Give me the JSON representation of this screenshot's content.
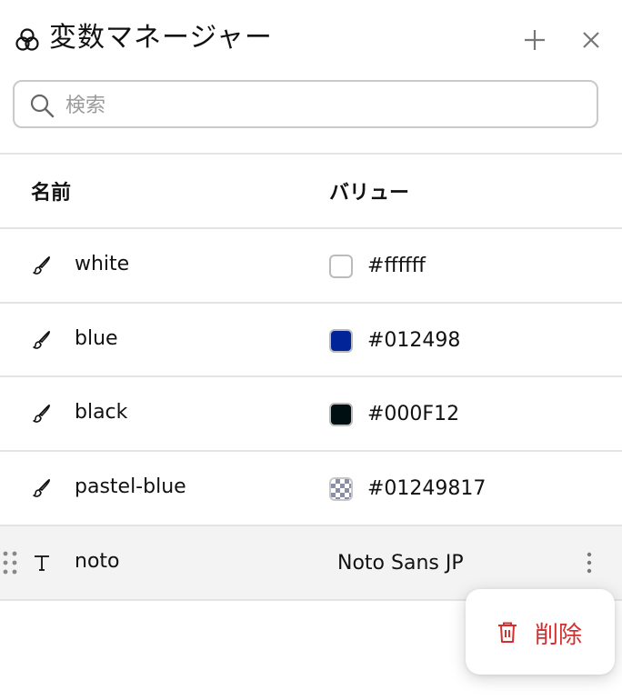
{
  "header": {
    "title": "変数マネージャー",
    "icons": {
      "title": "circles-icon",
      "add": "plus-icon",
      "close": "close-icon"
    }
  },
  "search": {
    "placeholder": "検索",
    "value": ""
  },
  "table": {
    "columns": {
      "name": "名前",
      "value": "バリュー"
    },
    "rows": [
      {
        "name": "white",
        "kind": "color",
        "kind_icon": "paintbrush-icon",
        "value": "#ffffff",
        "swatch": "#ffffff"
      },
      {
        "name": "blue",
        "kind": "color",
        "kind_icon": "paintbrush-icon",
        "value": "#012498",
        "swatch": "#012498"
      },
      {
        "name": "black",
        "kind": "color",
        "kind_icon": "paintbrush-icon",
        "value": "#000F12",
        "swatch": "#000F12"
      },
      {
        "name": "pastel-blue",
        "kind": "color",
        "kind_icon": "paintbrush-icon",
        "value": "#01249817",
        "swatch": "#01249817",
        "swatch_style": "checkerboard"
      },
      {
        "name": "noto",
        "kind": "font",
        "kind_icon": "text-type-icon",
        "value": "Noto Sans JP",
        "selected": true
      }
    ]
  },
  "context_menu": {
    "delete_label": "削除",
    "delete_color": "#d32f2f",
    "icon": "trash-icon"
  }
}
